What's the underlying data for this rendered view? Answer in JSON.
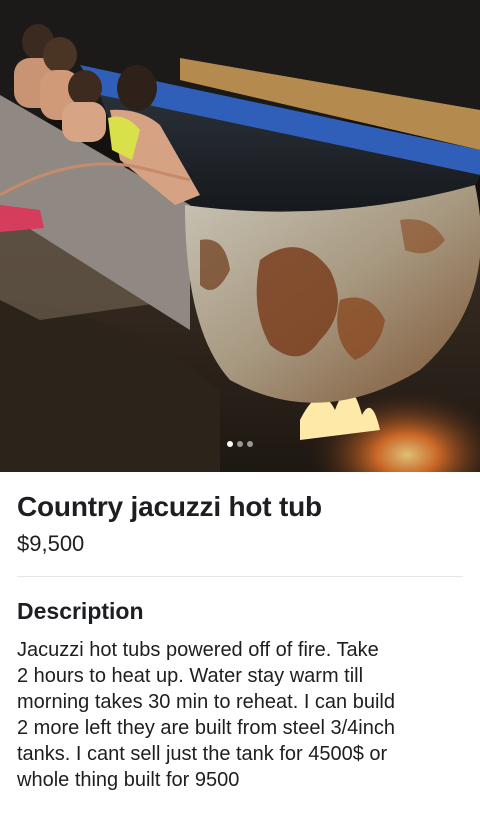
{
  "listing": {
    "photo": {
      "alt_scene": "fire-heated steel tank hot tub",
      "pager_total": 3,
      "pager_active": 1
    },
    "title": "Country jacuzzi hot tub",
    "price": "$9,500",
    "description_heading": "Description",
    "description_body": "Jacuzzi hot tubs powered off of fire. Take\n2 hours to heat up. Water stay warm till\nmorning takes 30 min to reheat. I can build\n2 more left they are built from steel 3/4inch\ntanks. I cant sell just the tank for 4500$ or\nwhole thing built for 9500"
  },
  "colors": {
    "text": "#1c1e21",
    "divider": "#e4e6eb",
    "tank_blue": "#2f5fb8",
    "rust": "#8a4a22"
  }
}
